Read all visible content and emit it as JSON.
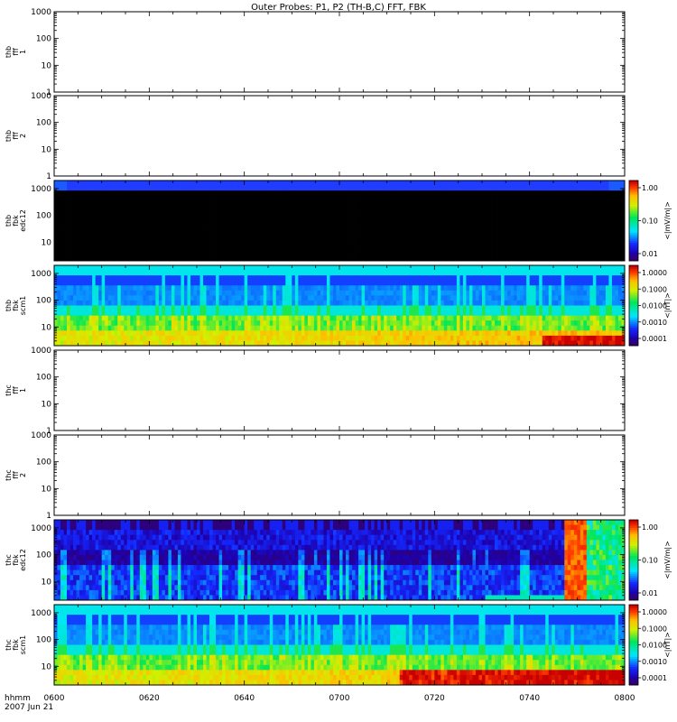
{
  "title": "Outer Probes: P1, P2 (TH-B,C) FFT, FBK",
  "time_axis_label": [
    "hhmm",
    "2007 Jun 21"
  ],
  "time_ticks": [
    "0600",
    "0620",
    "0640",
    "0700",
    "0720",
    "0740",
    "0800"
  ],
  "chart_data": [
    {
      "type": "heatmap",
      "ylabel": [
        "thb",
        "fff",
        "1"
      ],
      "yscale": "log",
      "ylim": [
        1,
        1000
      ],
      "yticks": [
        "1",
        "10",
        "100",
        "1000"
      ],
      "has_data": false
    },
    {
      "type": "heatmap",
      "ylabel": [
        "thb",
        "fff",
        "2"
      ],
      "yscale": "log",
      "ylim": [
        1,
        1000
      ],
      "yticks": [
        "1",
        "10",
        "100",
        "1000"
      ],
      "has_data": false
    },
    {
      "type": "heatmap",
      "ylabel": [
        "thb",
        "fbk",
        "edc12"
      ],
      "yscale": "log",
      "ylim": [
        2,
        2000
      ],
      "yticks": [
        "10",
        "100",
        "1000"
      ],
      "has_data": true,
      "pattern": "black_fill_blue_top",
      "colorbar": {
        "ticks": [
          "1.00",
          "0.10",
          "0.01"
        ],
        "label": "<|mV/m|>"
      }
    },
    {
      "type": "heatmap",
      "ylabel": [
        "thb",
        "fbk",
        "scm1"
      ],
      "yscale": "log",
      "ylim": [
        2,
        2000
      ],
      "yticks": [
        "10",
        "100",
        "1000"
      ],
      "has_data": true,
      "pattern": "scm_bands",
      "colorbar": {
        "ticks": [
          "1.0000",
          "0.1000",
          "0.0100",
          "0.0010",
          "0.0001"
        ],
        "label": "<|nT|>"
      }
    },
    {
      "type": "heatmap",
      "ylabel": [
        "thc",
        "fff",
        "1"
      ],
      "yscale": "log",
      "ylim": [
        1,
        1000
      ],
      "yticks": [
        "1",
        "10",
        "100",
        "1000"
      ],
      "has_data": false
    },
    {
      "type": "heatmap",
      "ylabel": [
        "thc",
        "fff",
        "2"
      ],
      "yscale": "log",
      "ylim": [
        1,
        1000
      ],
      "yticks": [
        "1",
        "10",
        "100",
        "1000"
      ],
      "has_data": false
    },
    {
      "type": "heatmap",
      "ylabel": [
        "thc",
        "fbk",
        "edc12"
      ],
      "yscale": "log",
      "ylim": [
        2,
        2000
      ],
      "yticks": [
        "10",
        "100",
        "1000"
      ],
      "has_data": true,
      "pattern": "edc_storm",
      "colorbar": {
        "ticks": [
          "1.00",
          "0.10",
          "0.01"
        ],
        "label": "<|mV/m|>"
      }
    },
    {
      "type": "heatmap",
      "ylabel": [
        "thc",
        "fbk",
        "scm1"
      ],
      "yscale": "log",
      "ylim": [
        2,
        2000
      ],
      "yticks": [
        "10",
        "100",
        "1000"
      ],
      "has_data": true,
      "pattern": "scm_bands_hot",
      "colorbar": {
        "ticks": [
          "1.0000",
          "0.1000",
          "0.0100",
          "0.0010",
          "0.0001"
        ],
        "label": "<|nT|>"
      }
    }
  ]
}
